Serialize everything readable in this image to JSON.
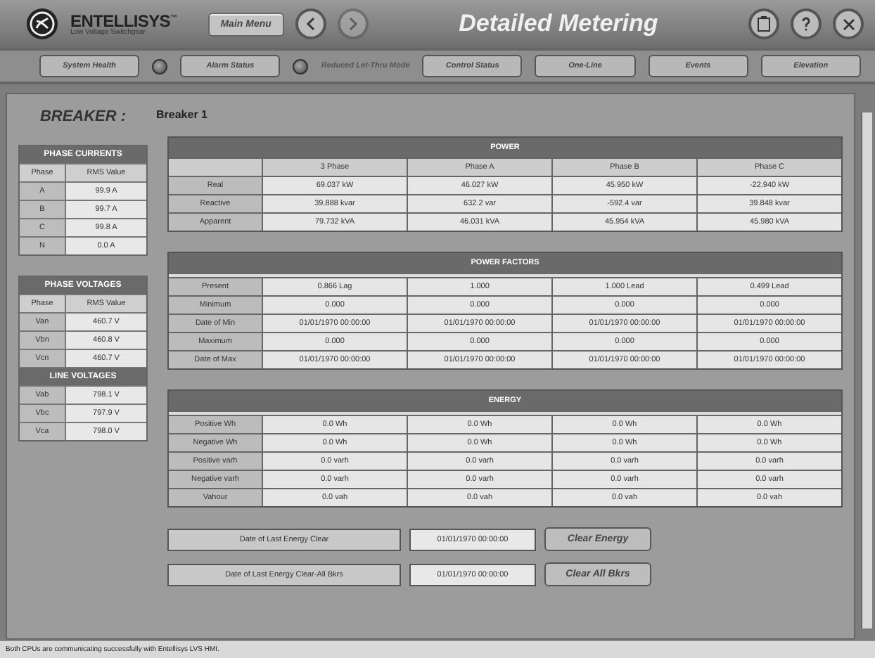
{
  "header": {
    "brand": "ENTELLISYS",
    "trademark": "™",
    "subtitle": "Low Voltage Switchgear",
    "main_menu": "Main Menu",
    "back_enabled": true,
    "forward_enabled": false,
    "title": "Detailed Metering"
  },
  "nav": [
    {
      "kind": "button",
      "label": "System Health"
    },
    {
      "kind": "led"
    },
    {
      "kind": "button",
      "label": "Alarm Status"
    },
    {
      "kind": "led"
    },
    {
      "kind": "label",
      "label": "Reduced Let-Thru Mode"
    },
    {
      "kind": "button",
      "label": "Control Status"
    },
    {
      "kind": "button",
      "label": "One-Line"
    },
    {
      "kind": "button",
      "label": "Events"
    },
    {
      "kind": "button",
      "label": "Elevation"
    }
  ],
  "breaker": {
    "label": "BREAKER :",
    "value": "Breaker 1"
  },
  "left_panels": [
    {
      "title": "PHASE CURRENTS",
      "columns": [
        "Phase",
        "RMS Value"
      ],
      "rows": [
        [
          "A",
          "99.9 A"
        ],
        [
          "B",
          "99.7 A"
        ],
        [
          "C",
          "99.8 A"
        ],
        [
          "N",
          "0.0 A"
        ]
      ]
    },
    {
      "title": "PHASE VOLTAGES",
      "columns": [
        "Phase",
        "RMS Value"
      ],
      "rows": [
        [
          "Van",
          "460.7 V"
        ],
        [
          "Vbn",
          "460.8 V"
        ],
        [
          "Vcn",
          "460.7 V"
        ]
      ],
      "subtitle": "LINE VOLTAGES",
      "subrows": [
        [
          "Vab",
          "798.1 V"
        ],
        [
          "Vbc",
          "797.9 V"
        ],
        [
          "Vca",
          "798.0 V"
        ]
      ]
    }
  ],
  "sections": [
    {
      "title": "POWER",
      "columns": [
        "3 Phase",
        "Phase A",
        "Phase B",
        "Phase C"
      ],
      "rows": [
        {
          "label": "Real",
          "cells": [
            "69.037 kW",
            "46.027 kW",
            "45.950 kW",
            "-22.940 kW"
          ]
        },
        {
          "label": "Reactive",
          "cells": [
            "39.888 kvar",
            "632.2 var",
            "-592.4 var",
            "39.848 kvar"
          ]
        },
        {
          "label": "Apparent",
          "cells": [
            "79.732 kVA",
            "46.031 kVA",
            "45.954 kVA",
            "45.980 kVA"
          ]
        }
      ]
    },
    {
      "title": "POWER FACTORS",
      "rows": [
        {
          "label": "Present",
          "cells": [
            "0.866 Lag",
            "1.000",
            "1.000 Lead",
            "0.499 Lead"
          ]
        },
        {
          "label": "Minimum",
          "cells": [
            "0.000",
            "0.000",
            "0.000",
            "0.000"
          ]
        },
        {
          "label": "Date of Min",
          "cells": [
            "01/01/1970 00:00:00",
            "01/01/1970 00:00:00",
            "01/01/1970 00:00:00",
            "01/01/1970 00:00:00"
          ]
        },
        {
          "label": "Maximum",
          "cells": [
            "0.000",
            "0.000",
            "0.000",
            "0.000"
          ]
        },
        {
          "label": "Date of Max",
          "cells": [
            "01/01/1970 00:00:00",
            "01/01/1970 00:00:00",
            "01/01/1970 00:00:00",
            "01/01/1970 00:00:00"
          ]
        }
      ]
    },
    {
      "title": "ENERGY",
      "rows": [
        {
          "label": "Positive Wh",
          "cells": [
            "0.0 Wh",
            "0.0 Wh",
            "0.0 Wh",
            "0.0 Wh"
          ]
        },
        {
          "label": "Negative Wh",
          "cells": [
            "0.0 Wh",
            "0.0 Wh",
            "0.0 Wh",
            "0.0 Wh"
          ]
        },
        {
          "label": "Positive varh",
          "cells": [
            "0.0 varh",
            "0.0 varh",
            "0.0 varh",
            "0.0 varh"
          ]
        },
        {
          "label": "Negative varh",
          "cells": [
            "0.0 varh",
            "0.0 varh",
            "0.0 varh",
            "0.0 varh"
          ]
        },
        {
          "label": "Vahour",
          "cells": [
            "0.0 vah",
            "0.0 vah",
            "0.0 vah",
            "0.0 vah"
          ]
        }
      ]
    }
  ],
  "clears": [
    {
      "label": "Date of Last Energy Clear",
      "value": "01/01/1970 00:00:00",
      "button": "Clear Energy"
    },
    {
      "label": "Date of Last Energy Clear-All Bkrs",
      "value": "01/01/1970 00:00:00",
      "button": "Clear All Bkrs"
    }
  ],
  "status_bar": "Both CPUs are communicating successfully with Entellisys LVS HMI."
}
